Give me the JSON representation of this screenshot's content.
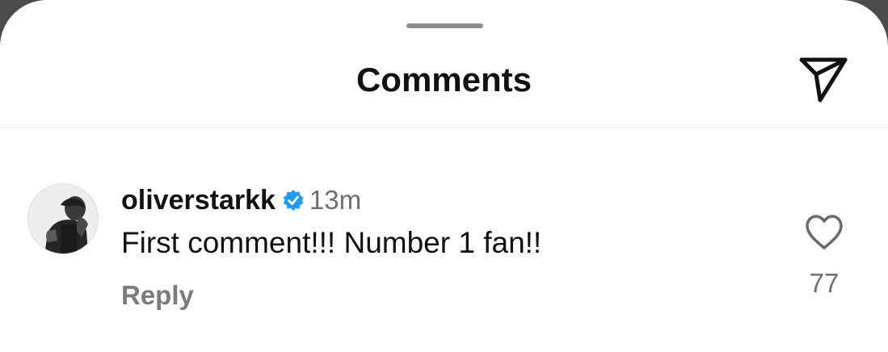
{
  "sheet": {
    "title": "Comments",
    "share_icon": "paper-plane-icon"
  },
  "comment": {
    "avatar_icon": "user-avatar",
    "username": "oliverstarkk",
    "verified_icon": "verified-badge-icon",
    "time": "13m",
    "text": "First comment!!! Number 1 fan!!",
    "reply_label": "Reply",
    "like_icon": "heart-outline-icon",
    "like_count": "77"
  },
  "colors": {
    "verified_blue": "#1d9bf0",
    "text_primary": "#111111",
    "text_secondary": "#6f6f6f"
  }
}
